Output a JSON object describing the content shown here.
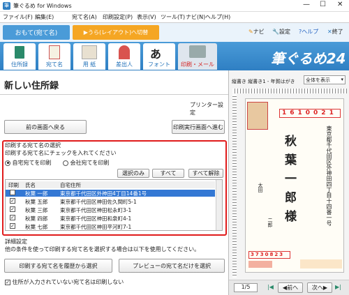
{
  "window": {
    "title": "筆ぐるめ for Windows"
  },
  "menu": [
    "ファイル(F)",
    "編集(E)",
    "宛て名(A)",
    "印刷設定(P)",
    "表示(V)",
    "ツール(T)",
    "ナビ(N)",
    "ヘルプ(H)"
  ],
  "mode": {
    "active": "おもて(宛て名)",
    "switch": "▶うら(レイアウト)へ切替",
    "navi": "ナビ",
    "settings": "設定",
    "help": "?ヘルプ",
    "exit": "終了"
  },
  "tabs": [
    "住所録",
    "宛て名",
    "用 紙",
    "差出人",
    "フォント",
    "印刷・メール"
  ],
  "brand": "筆ぐるめ24",
  "page_title": "新しい住所録",
  "printer_settings": "プリンター設定",
  "buttons": {
    "back": "前の画面へ戻る",
    "next": "印刷実行画面へ進む",
    "select_only": "選択のみ",
    "all": "すべて",
    "clear_all": "すべて解除",
    "history": "印刷する宛て名を履歴から選択",
    "preview_name": "プレビューの宛て名だけを選択"
  },
  "select_section": {
    "title": "印刷する宛て名の選択",
    "instruction": "印刷する宛て名にチェックを入れてください",
    "radio_home": "自宅宛てを印刷",
    "radio_company": "会社宛てを印刷"
  },
  "table": {
    "headers": [
      "印刷",
      "氏名",
      "自宅住所"
    ],
    "rows": [
      {
        "name": "秋葉 一郎",
        "address": "東京都千代田区外神田4丁目14番1号"
      },
      {
        "name": "秋葉 五郎",
        "address": "東京都千代田区神田佐久間町5-1"
      },
      {
        "name": "秋葉 三郎",
        "address": "東京都千代田区神田松永町3-1"
      },
      {
        "name": "秋葉 四郎",
        "address": "東京都千代田区神田和泉町4-1"
      },
      {
        "name": "秋葉 七郎",
        "address": "東京都千代田区神田平河町7-1"
      }
    ]
  },
  "detail": {
    "title": "詳細設定",
    "desc": "他の条件を使って印刷する宛て名を選択する場合は以下を使用してください。",
    "check_label": "住所が入力されていない宛て名は印刷しない"
  },
  "preview": {
    "label": "縦書き 縦書き1 - 年賀はがき",
    "display": "全体を表示",
    "postal": "1610021",
    "name_chars": [
      "秋",
      "葉",
      "一",
      "郎",
      "様"
    ],
    "address": "東京都千代田区外神田四丁目十四番一号",
    "sender_postal": "3730823",
    "sender_name": "太田",
    "sender_given": "二郎",
    "page": "1/5",
    "prev": "前へ",
    "next": "次へ"
  },
  "colors": {
    "accent": "#2f7fc3",
    "highlight": "#e01b1b",
    "select_row": "#3478d4"
  }
}
